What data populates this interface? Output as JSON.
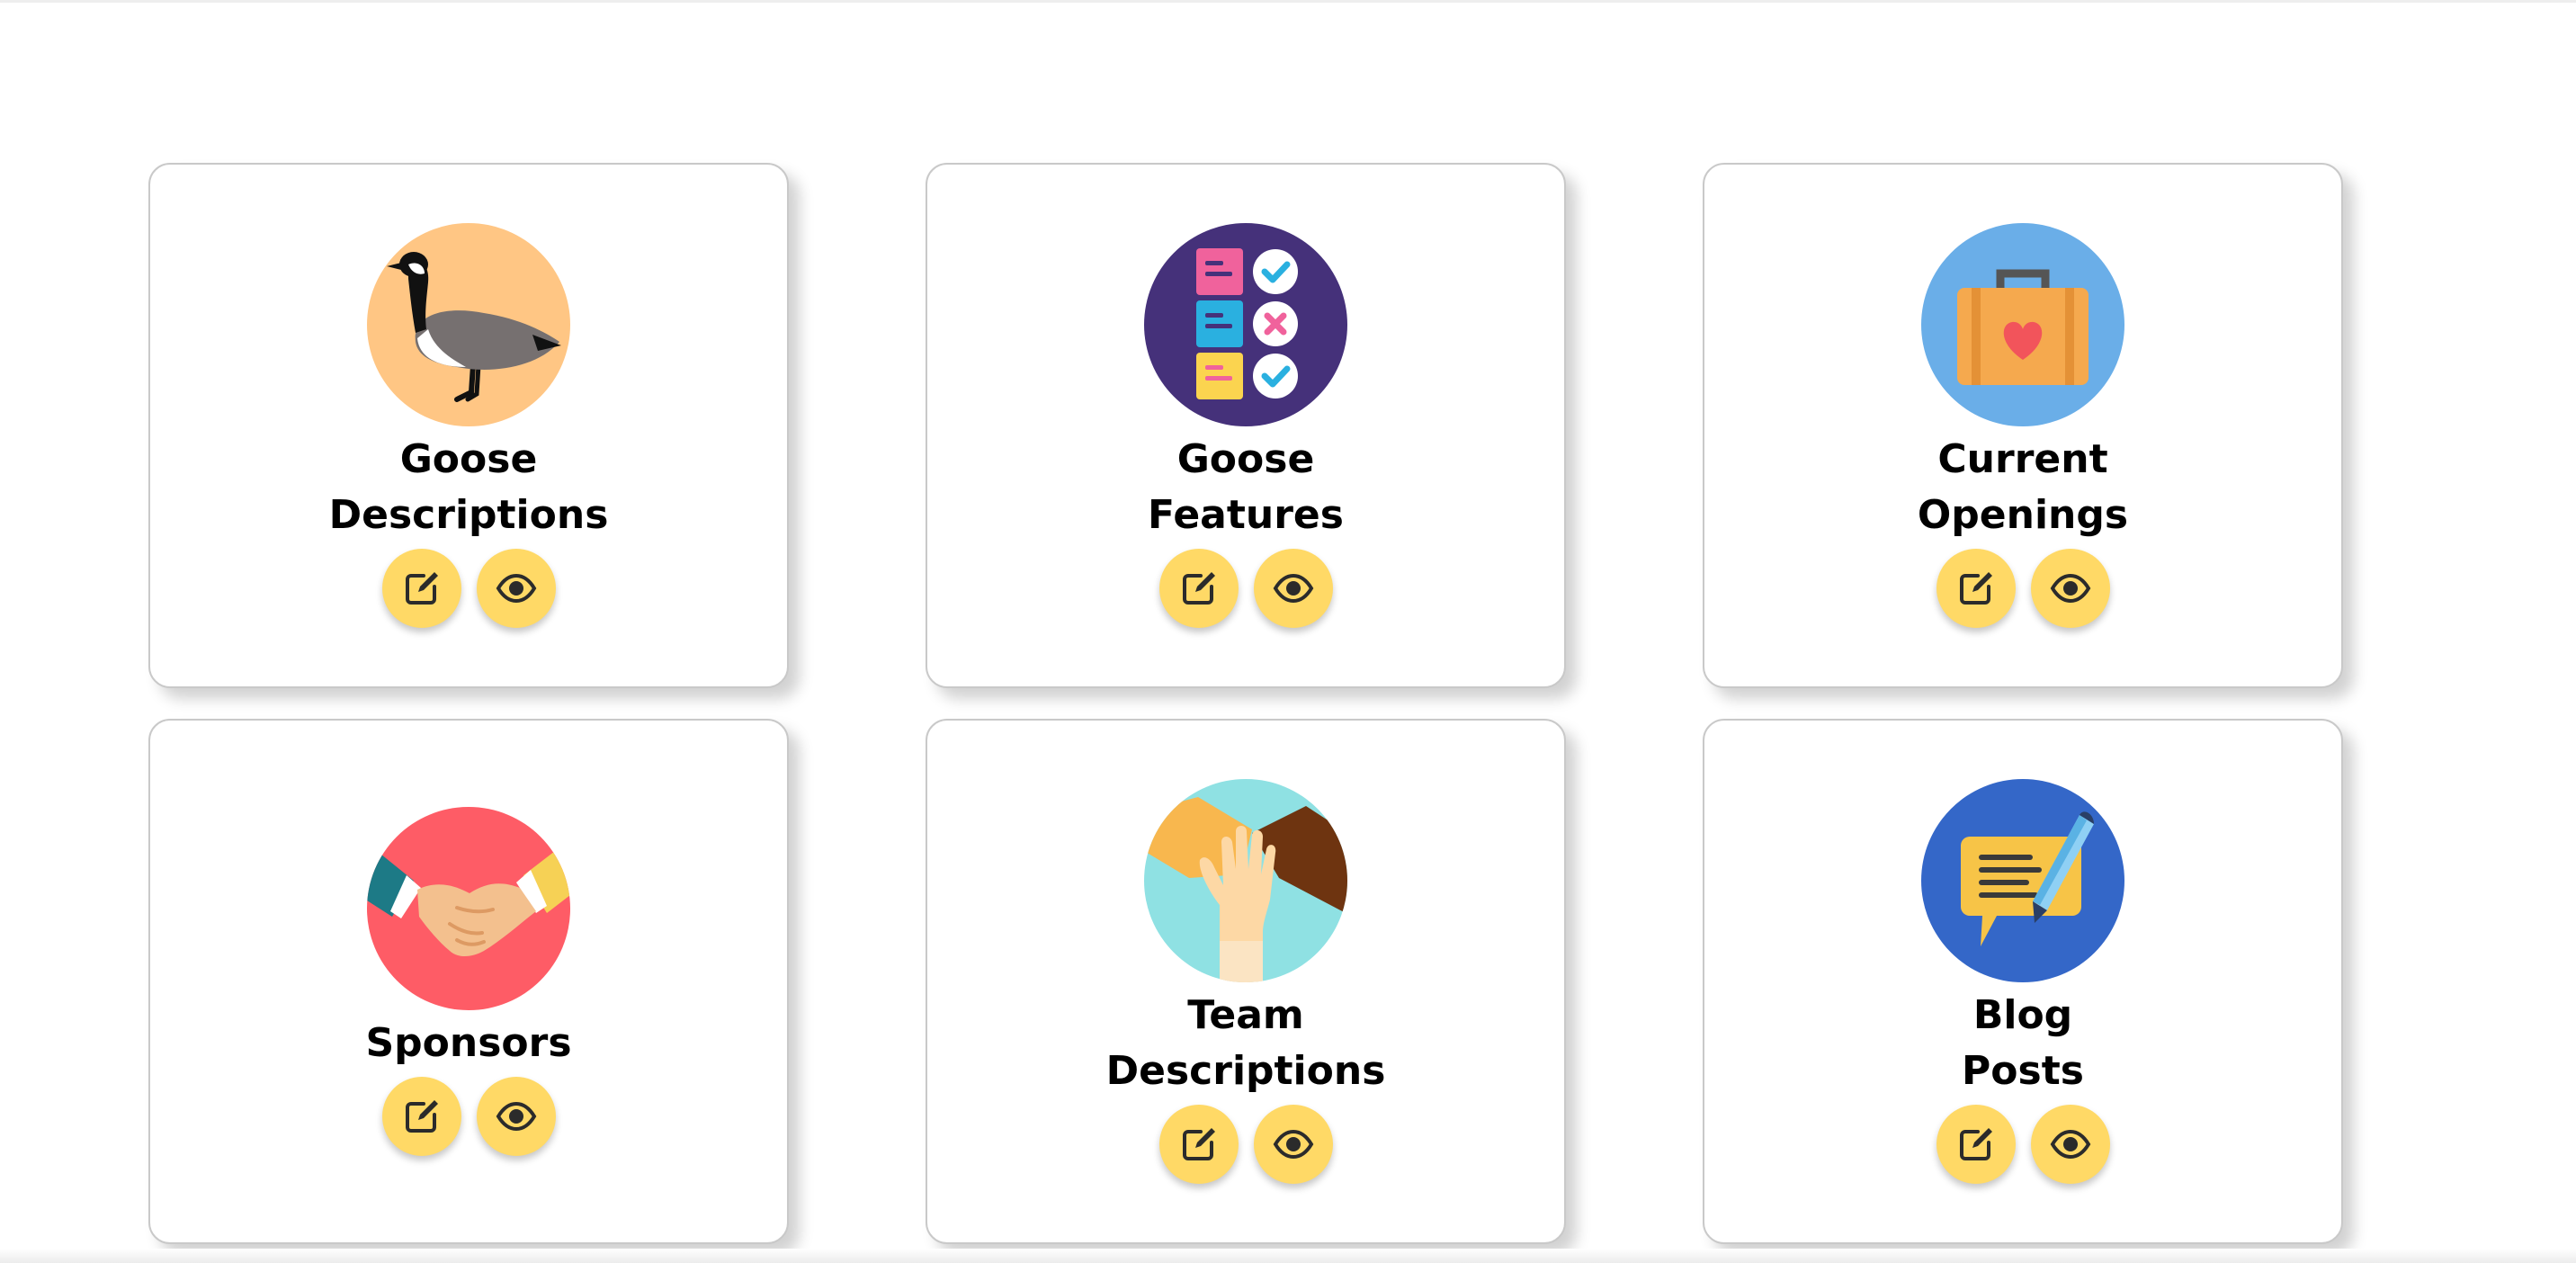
{
  "cards": [
    {
      "title_line1": "Goose",
      "title_line2": "Descriptions",
      "icon": "goose-icon",
      "icon_bg": "#ffc684"
    },
    {
      "title_line1": "Goose",
      "title_line2": "Features",
      "icon": "checklist-icon",
      "icon_bg": "#45317a"
    },
    {
      "title_line1": "Current",
      "title_line2": "Openings",
      "icon": "briefcase-heart-icon",
      "icon_bg": "#6aaee8"
    },
    {
      "title_line1": "Sponsors",
      "title_line2": "",
      "icon": "handshake-icon",
      "icon_bg": "#fe5c66"
    },
    {
      "title_line1": "Team",
      "title_line2": "Descriptions",
      "icon": "team-hands-icon",
      "icon_bg": "#8fe1e3"
    },
    {
      "title_line1": "Blog",
      "title_line2": "Posts",
      "icon": "blog-post-icon",
      "icon_bg": "#3467c8"
    }
  ],
  "actions": {
    "edit_icon": "edit-icon",
    "view_icon": "eye-icon",
    "button_color": "#ffd966"
  }
}
